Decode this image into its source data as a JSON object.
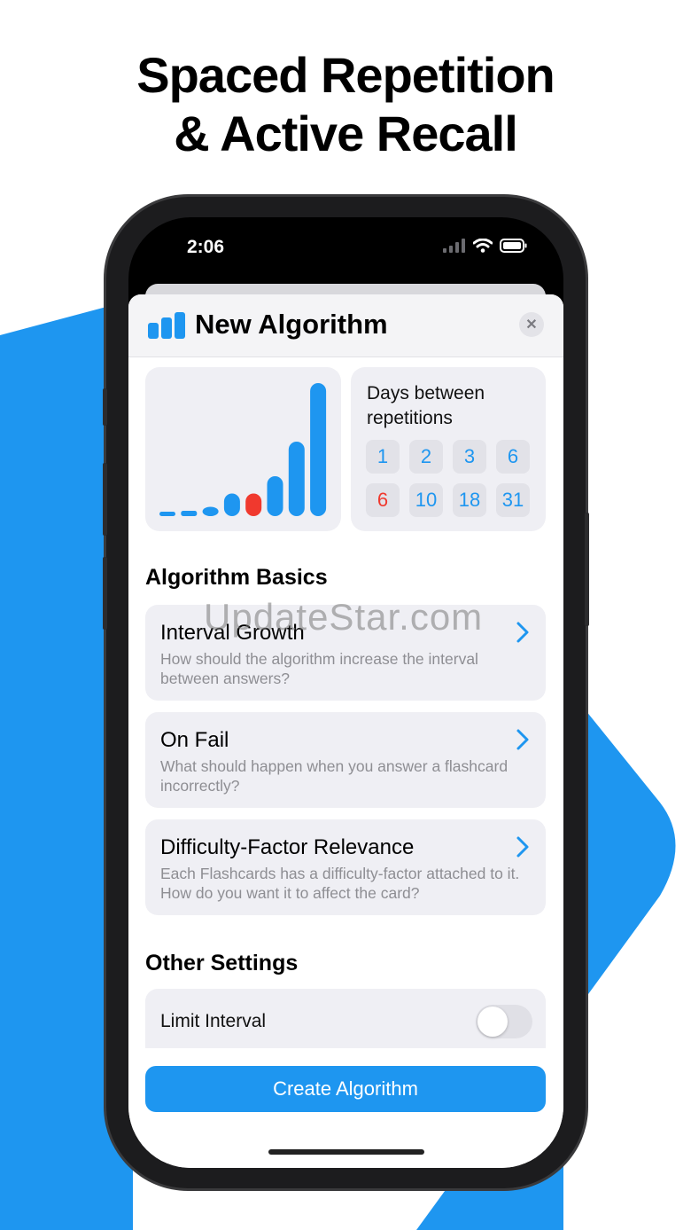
{
  "colors": {
    "accent": "#1e96f0",
    "fail": "#f0392e",
    "background_shape": "#1e96f0"
  },
  "headline": {
    "line1": "Spaced Repetition",
    "line2": "& Active Recall"
  },
  "status_bar": {
    "time": "2:06",
    "icons": [
      "cellular-signal-icon",
      "wifi-icon",
      "battery-icon"
    ]
  },
  "sheet": {
    "title": "New Algorithm",
    "title_icon": "bar-chart-icon",
    "close_icon": "close-icon",
    "close_label": "✕"
  },
  "interval_chart": {
    "bars": [
      {
        "level": 0.02,
        "fail": false
      },
      {
        "level": 0.04,
        "fail": false
      },
      {
        "level": 0.07,
        "fail": false
      },
      {
        "level": 0.17,
        "fail": false
      },
      {
        "level": 0.17,
        "fail": true
      },
      {
        "level": 0.3,
        "fail": false
      },
      {
        "level": 0.56,
        "fail": false
      },
      {
        "level": 1.0,
        "fail": false
      }
    ]
  },
  "days_card": {
    "title": "Days between repetitions",
    "days": [
      {
        "value": "1",
        "fail": false
      },
      {
        "value": "2",
        "fail": false
      },
      {
        "value": "3",
        "fail": false
      },
      {
        "value": "6",
        "fail": false
      },
      {
        "value": "6",
        "fail": true
      },
      {
        "value": "10",
        "fail": false
      },
      {
        "value": "18",
        "fail": false
      },
      {
        "value": "31",
        "fail": false
      }
    ]
  },
  "algorithm_basics": {
    "title": "Algorithm Basics",
    "items": [
      {
        "title": "Interval Growth",
        "description": "How should the algorithm increase the interval between answers?"
      },
      {
        "title": "On Fail",
        "description": "What should happen when you answer a flashcard incorrectly?"
      },
      {
        "title": "Difficulty-Factor Relevance",
        "description": "Each Flashcards has a difficulty-factor attached to it. How do you want it to affect the card?"
      }
    ]
  },
  "other_settings": {
    "title": "Other Settings",
    "limit_interval": {
      "label": "Limit Interval",
      "on": false
    }
  },
  "create_button": {
    "label": "Create Algorithm"
  },
  "watermark": "UpdateStar.com"
}
